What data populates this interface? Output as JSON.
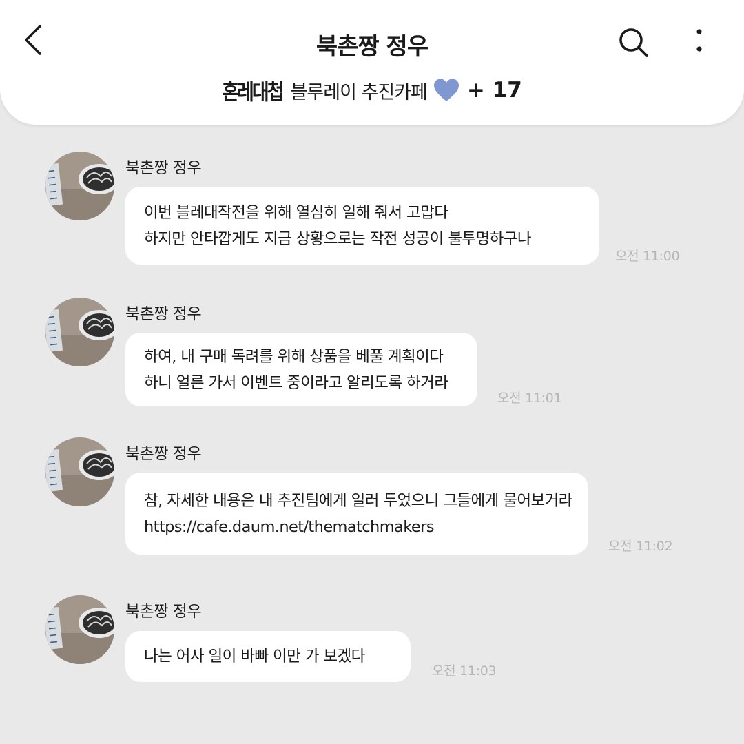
{
  "header": {
    "title": "북촌짱 정우",
    "brand_logo_text": "혼레대첩",
    "subtitle": "블루레이 추진카페",
    "member_count": "+ 17",
    "heart_color": "#7f98d2",
    "icons": {
      "back": "chevron-left-icon",
      "search": "search-icon",
      "more": "more-vertical-icon"
    }
  },
  "messages": [
    {
      "sender": "북촌짱 정우",
      "lines": [
        "이번 블레대작전을 위해 열심히 일해 줘서 고맙다",
        "하지만 안타깝게도 지금 상황으로는 작전 성공이 불투명하구나"
      ],
      "time": "오전 11:00"
    },
    {
      "sender": "북촌짱 정우",
      "lines": [
        "하여, 내 구매 독려를 위해 상품을 베풀 계획이다",
        "하니 얼른 가서 이벤트 중이라고 알리도록 하거라"
      ],
      "time": "오전 11:01"
    },
    {
      "sender": "북촌짱 정우",
      "lines": [
        "참, 자세한 내용은 내 추진팀에게 일러 두었으니 그들에게 물어보거라",
        "https://cafe.daum.net/thematchmakers"
      ],
      "time": "오전 11:02"
    },
    {
      "sender": "북촌짱 정우",
      "lines": [
        "나는 어사 일이 바빠 이만 가 보겠다"
      ],
      "time": "오전 11:03"
    }
  ]
}
